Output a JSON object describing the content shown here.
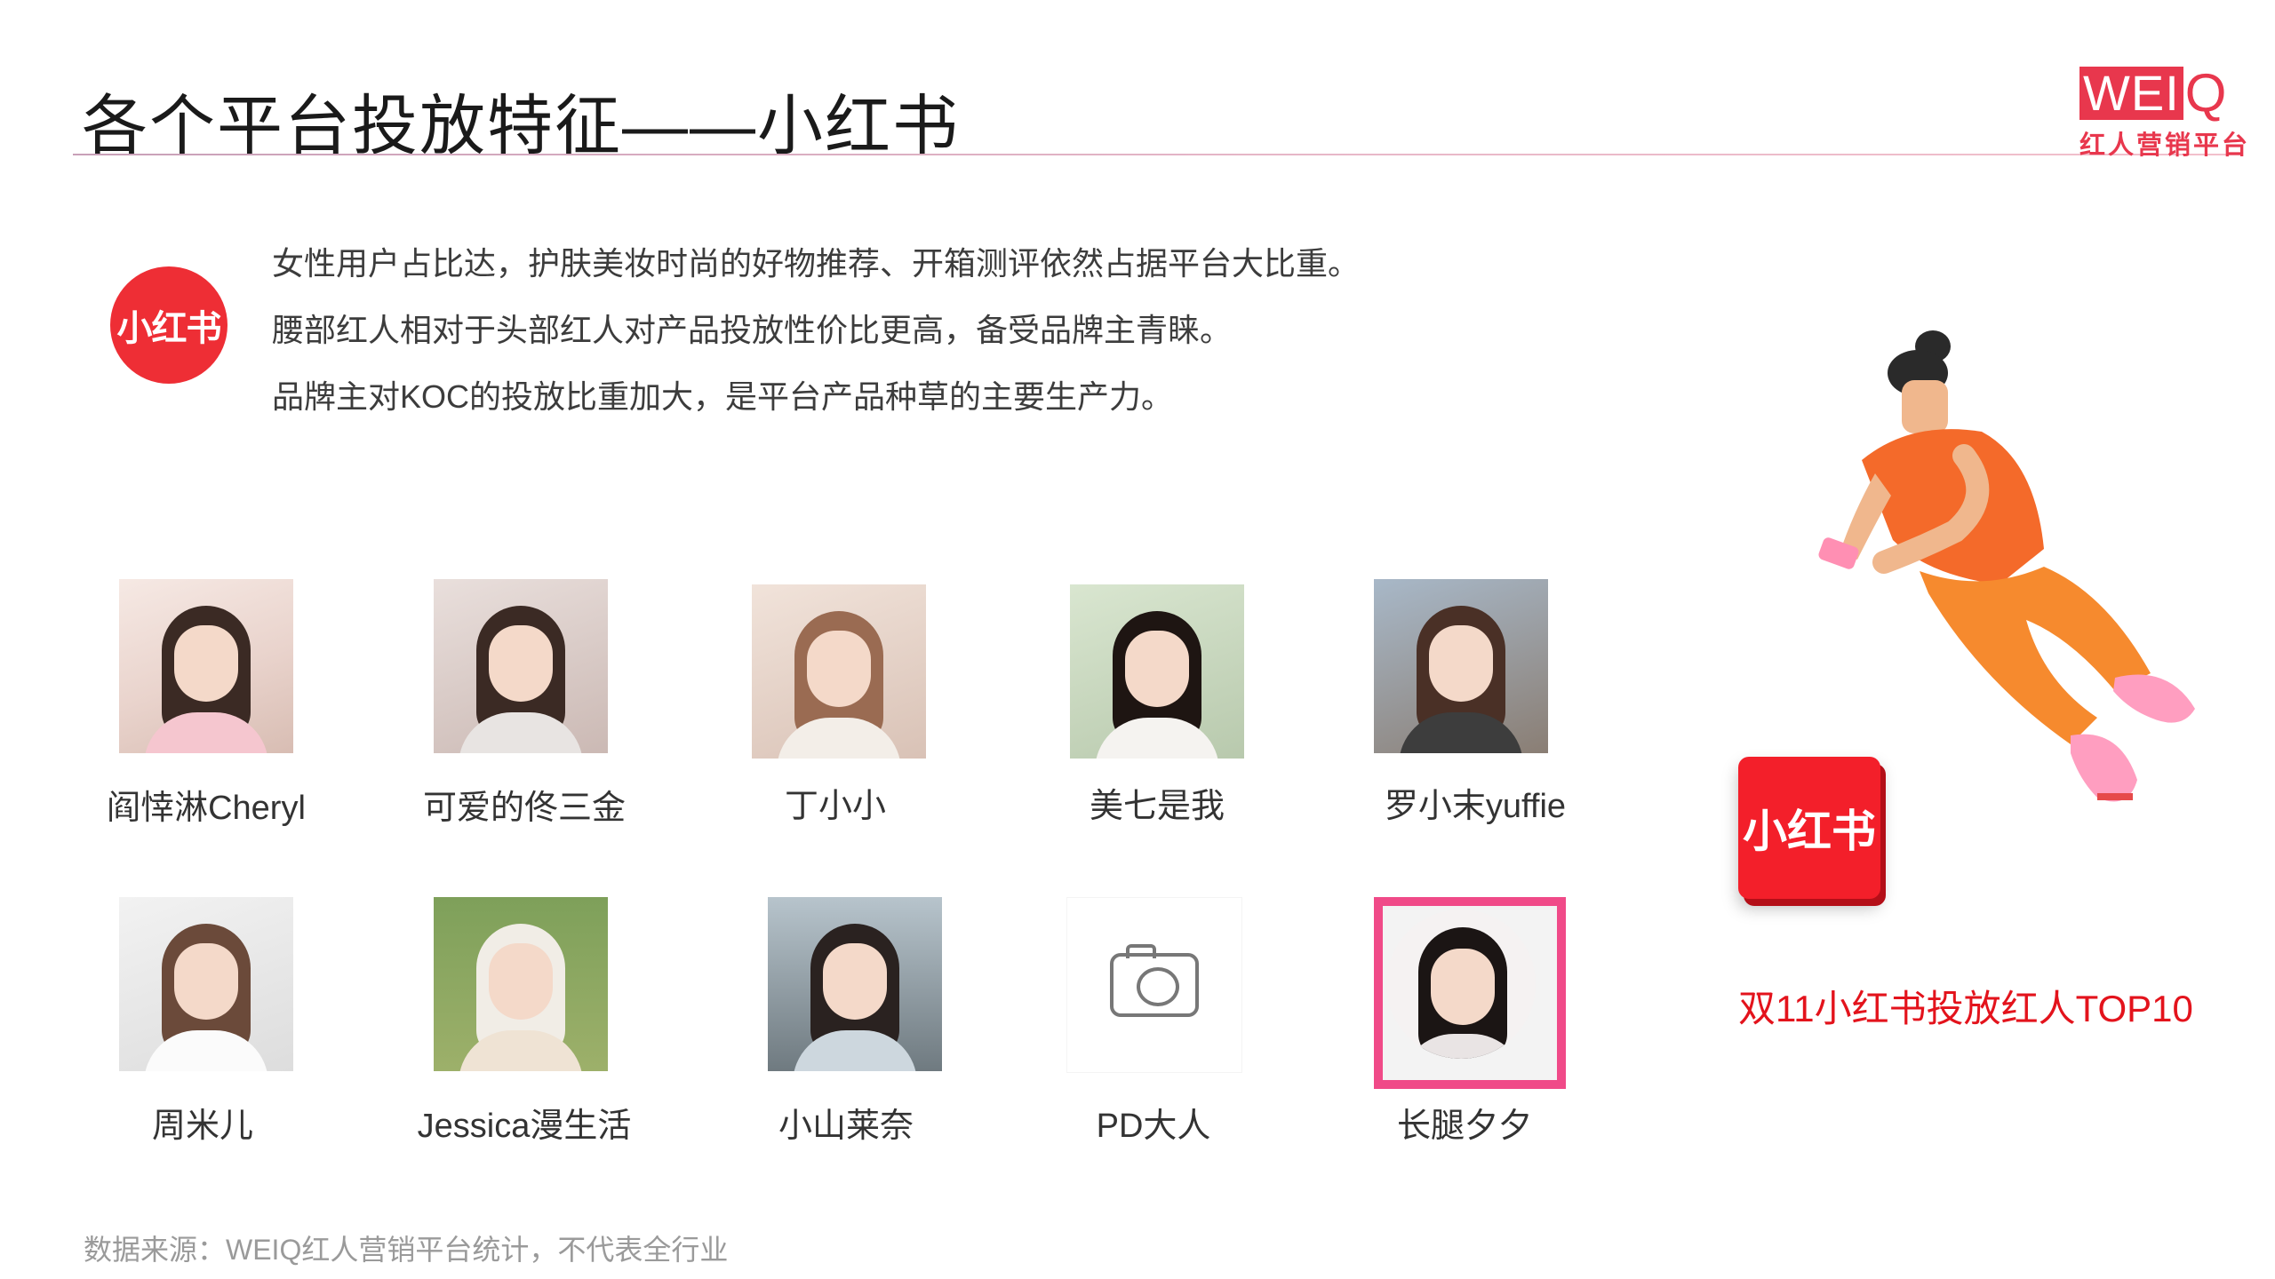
{
  "title": "各个平台投放特征——小红书",
  "logo": {
    "wei": "WEI",
    "q": "Q",
    "sub": "红人营销平台"
  },
  "platform_badge": "小红书",
  "bullets": [
    "女性用户占比达，护肤美妆时尚的好物推荐、开箱测评依然占据平台大比重。",
    "腰部红人相对于头部红人对产品投放性价比更高，备受品牌主青睐。",
    "品牌主对KOC的投放比重加大，是平台产品种草的主要生产力。"
  ],
  "kols": [
    {
      "name": "阎悻淋Cheryl"
    },
    {
      "name": "可爱的佟三金"
    },
    {
      "name": "丁小小"
    },
    {
      "name": "美七是我"
    },
    {
      "name": "罗小末yuffie"
    },
    {
      "name": "周米儿"
    },
    {
      "name": "Jessica漫生活"
    },
    {
      "name": "小山莱奈"
    },
    {
      "name": "PD大人",
      "icon": "camera-icon"
    },
    {
      "name": "长腿夕夕"
    }
  ],
  "caption": "双11小红书投放红人TOP10",
  "source": "数据来源：WEIQ红人营销平台统计，不代表全行业",
  "colors": {
    "accent": "#e3131c",
    "brand": "#e8374d",
    "xhs_red": "#f31f2a"
  }
}
